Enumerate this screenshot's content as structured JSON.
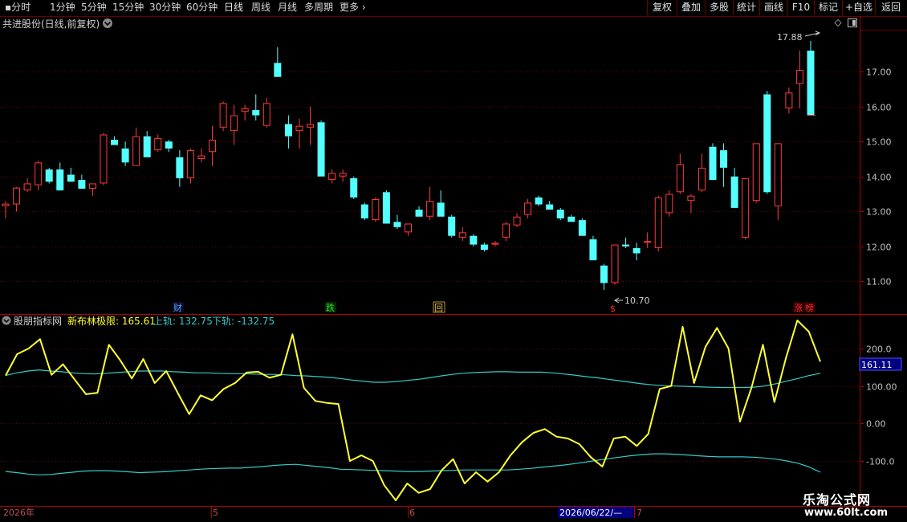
{
  "toolbar": {
    "periods": [
      "分时",
      "1分钟",
      "5分钟",
      "15分钟",
      "30分钟",
      "60分钟",
      "日线",
      "周线",
      "月线",
      "多周期",
      "更多"
    ],
    "active_period": "日线",
    "right_buttons": [
      "复权",
      "叠加",
      "多股",
      "统计",
      "画线",
      "F10",
      "标记",
      "+自选",
      "返回"
    ]
  },
  "main_panel": {
    "title": "共进股份(日线,前复权)",
    "high_label": "17.88",
    "low_label": "10.70",
    "price_ticks": [
      "17.00",
      "16.00",
      "15.00",
      "14.00",
      "13.00",
      "12.00",
      "11.00"
    ],
    "event_markers": [
      {
        "text": "财",
        "color": "#4aa8ff"
      },
      {
        "text": "跌",
        "color": "#33dd33"
      },
      {
        "text": "回",
        "color": "#e8c040"
      },
      {
        "text": "$",
        "color": "#ff3030"
      },
      {
        "text": "涨",
        "color": "#ff3030"
      },
      {
        "text": "榜",
        "color": "#ff3030"
      }
    ]
  },
  "indicator_panel": {
    "name": "股朋指标网",
    "label1": "新布林极限: 165.61",
    "label2": "上轨: 132.75",
    "label3": "下轨: -132.75",
    "current_value": "161.11",
    "ticks": [
      "200.0",
      "100.00",
      "0.00",
      "-100.0"
    ]
  },
  "time_axis": {
    "labels": [
      "2026年",
      "5",
      "6",
      "2026/06/22/—",
      "7"
    ]
  },
  "watermark": {
    "title": "乐淘公式网",
    "url": "www.60lt.com"
  },
  "colors": {
    "up": "#ff3b3b",
    "down": "#54ffff",
    "grid": "#6a0000",
    "indicator_line": "#ffff33",
    "band_line": "#33cccc",
    "axis_text": "#c0c0c0"
  },
  "chart_data": {
    "type": "candlestick",
    "price_ylim": [
      10.5,
      18.2
    ],
    "indicator_ylim": [
      -220,
      290
    ],
    "candles": [
      [
        13.15,
        13.3,
        12.8,
        13.22
      ],
      [
        13.2,
        13.7,
        13.0,
        13.68
      ],
      [
        13.6,
        13.95,
        13.55,
        13.8
      ],
      [
        13.75,
        14.45,
        13.6,
        14.4
      ],
      [
        14.2,
        14.25,
        13.8,
        13.85
      ],
      [
        14.2,
        14.4,
        13.65,
        13.6
      ],
      [
        14.05,
        14.25,
        13.9,
        13.85
      ],
      [
        13.9,
        14.05,
        13.65,
        13.65
      ],
      [
        13.65,
        13.8,
        13.45,
        13.8
      ],
      [
        13.8,
        15.25,
        13.75,
        15.2
      ],
      [
        15.05,
        15.15,
        14.9,
        14.9
      ],
      [
        14.8,
        15.0,
        14.3,
        14.4
      ],
      [
        14.3,
        15.4,
        14.3,
        15.15
      ],
      [
        15.15,
        15.3,
        14.55,
        14.55
      ],
      [
        14.75,
        15.2,
        14.7,
        15.1
      ],
      [
        15.0,
        15.05,
        14.7,
        14.8
      ],
      [
        14.55,
        14.75,
        13.7,
        13.95
      ],
      [
        13.95,
        14.8,
        13.8,
        14.75
      ],
      [
        14.5,
        14.8,
        14.4,
        14.6
      ],
      [
        14.7,
        15.45,
        14.3,
        15.05
      ],
      [
        15.4,
        16.15,
        15.3,
        16.1
      ],
      [
        15.3,
        16.05,
        14.9,
        15.75
      ],
      [
        15.85,
        16.05,
        15.6,
        15.95
      ],
      [
        15.9,
        16.35,
        15.6,
        15.75
      ],
      [
        15.45,
        16.25,
        15.4,
        16.1
      ],
      [
        17.25,
        17.7,
        16.85,
        16.85
      ],
      [
        15.5,
        15.75,
        14.8,
        15.15
      ],
      [
        15.3,
        15.65,
        14.8,
        15.45
      ],
      [
        15.4,
        16.0,
        14.9,
        15.5
      ],
      [
        15.55,
        15.6,
        14.0,
        14.0
      ],
      [
        13.9,
        14.2,
        13.8,
        14.1
      ],
      [
        14.0,
        14.2,
        13.85,
        14.1
      ],
      [
        13.95,
        14.0,
        13.35,
        13.4
      ],
      [
        13.2,
        13.25,
        12.75,
        12.8
      ],
      [
        12.75,
        13.4,
        12.7,
        13.35
      ],
      [
        13.55,
        13.6,
        12.7,
        12.65
      ],
      [
        12.7,
        12.9,
        12.5,
        12.55
      ],
      [
        12.4,
        12.65,
        12.3,
        12.65
      ],
      [
        13.05,
        13.15,
        12.85,
        12.85
      ],
      [
        12.85,
        13.7,
        12.75,
        13.3
      ],
      [
        13.25,
        13.6,
        12.85,
        12.85
      ],
      [
        12.85,
        12.9,
        12.25,
        12.3
      ],
      [
        12.25,
        12.55,
        12.15,
        12.4
      ],
      [
        12.3,
        12.35,
        12.0,
        12.05
      ],
      [
        12.05,
        12.1,
        11.85,
        11.9
      ],
      [
        12.05,
        12.15,
        12.0,
        12.1
      ],
      [
        12.25,
        12.7,
        12.15,
        12.65
      ],
      [
        12.6,
        12.95,
        12.55,
        12.85
      ],
      [
        12.9,
        13.35,
        12.8,
        13.25
      ],
      [
        13.4,
        13.45,
        13.15,
        13.2
      ],
      [
        13.2,
        13.3,
        13.05,
        13.05
      ],
      [
        13.05,
        13.1,
        12.75,
        12.8
      ],
      [
        12.85,
        12.9,
        12.7,
        12.7
      ],
      [
        12.75,
        12.8,
        12.3,
        12.3
      ],
      [
        12.2,
        12.3,
        11.6,
        11.6
      ],
      [
        11.45,
        11.5,
        10.75,
        10.95
      ],
      [
        10.95,
        12.05,
        10.9,
        12.05
      ],
      [
        12.05,
        12.25,
        11.95,
        12.0
      ],
      [
        11.95,
        12.1,
        11.6,
        11.8
      ],
      [
        12.15,
        12.4,
        11.95,
        12.15
      ],
      [
        11.95,
        13.45,
        11.85,
        13.4
      ],
      [
        12.95,
        13.6,
        12.85,
        13.5
      ],
      [
        13.55,
        14.65,
        13.5,
        14.35
      ],
      [
        13.3,
        13.5,
        12.95,
        13.45
      ],
      [
        13.6,
        14.65,
        13.55,
        14.25
      ],
      [
        14.85,
        14.95,
        13.95,
        13.9
      ],
      [
        14.75,
        14.95,
        13.7,
        14.25
      ],
      [
        14.0,
        14.25,
        13.15,
        13.1
      ],
      [
        12.25,
        13.95,
        12.2,
        13.95
      ],
      [
        13.3,
        14.95,
        13.25,
        14.95
      ],
      [
        16.35,
        16.45,
        13.5,
        13.55
      ],
      [
        13.15,
        14.95,
        12.75,
        14.95
      ],
      [
        15.95,
        16.55,
        15.8,
        16.4
      ],
      [
        16.65,
        17.6,
        15.95,
        17.05
      ],
      [
        17.6,
        17.88,
        15.75,
        15.75
      ]
    ],
    "indicator": [
      128,
      185,
      200,
      225,
      130,
      158,
      118,
      78,
      82,
      210,
      168,
      120,
      172,
      108,
      140,
      82,
      25,
      75,
      62,
      92,
      108,
      136,
      138,
      122,
      130,
      238,
      95,
      60,
      55,
      52,
      -100,
      -85,
      -100,
      -165,
      -205,
      -160,
      -185,
      -175,
      -125,
      -95,
      -160,
      -130,
      -155,
      -130,
      -85,
      -50,
      -25,
      -15,
      -35,
      -40,
      -55,
      -90,
      -115,
      -40,
      -35,
      -60,
      -28,
      92,
      100,
      258,
      108,
      205,
      255,
      200,
      5,
      95,
      210,
      57,
      174,
      275,
      245,
      165
    ],
    "upper_band": [
      128,
      135,
      140,
      143,
      140,
      138,
      135,
      133,
      132,
      134,
      136,
      138,
      140,
      140,
      140,
      138,
      137,
      135,
      135,
      134,
      133,
      133,
      132,
      131,
      131,
      130,
      128,
      127,
      125,
      123,
      120,
      116,
      113,
      110,
      110,
      112,
      115,
      118,
      122,
      127,
      131,
      134,
      136,
      137,
      138,
      138,
      137,
      137,
      137,
      135,
      132,
      129,
      125,
      122,
      118,
      114,
      110,
      106,
      103,
      101,
      100,
      99,
      98,
      97,
      96,
      96,
      96,
      97,
      100,
      106,
      113,
      120,
      128,
      134
    ],
    "lower_band": [
      -128,
      -131,
      -135,
      -137,
      -136,
      -133,
      -130,
      -127,
      -126,
      -126,
      -127,
      -129,
      -131,
      -130,
      -129,
      -127,
      -125,
      -123,
      -121,
      -120,
      -119,
      -119,
      -117,
      -115,
      -112,
      -110,
      -109,
      -112,
      -115,
      -118,
      -122,
      -123,
      -124,
      -125,
      -126,
      -127,
      -128,
      -128,
      -127,
      -126,
      -125,
      -124,
      -124,
      -124,
      -124,
      -124,
      -122,
      -120,
      -117,
      -114,
      -111,
      -107,
      -103,
      -98,
      -94,
      -90,
      -86,
      -83,
      -81,
      -81,
      -82,
      -84,
      -86,
      -88,
      -89,
      -89,
      -89,
      -90,
      -92,
      -95,
      -100,
      -106,
      -116,
      -130
    ]
  }
}
